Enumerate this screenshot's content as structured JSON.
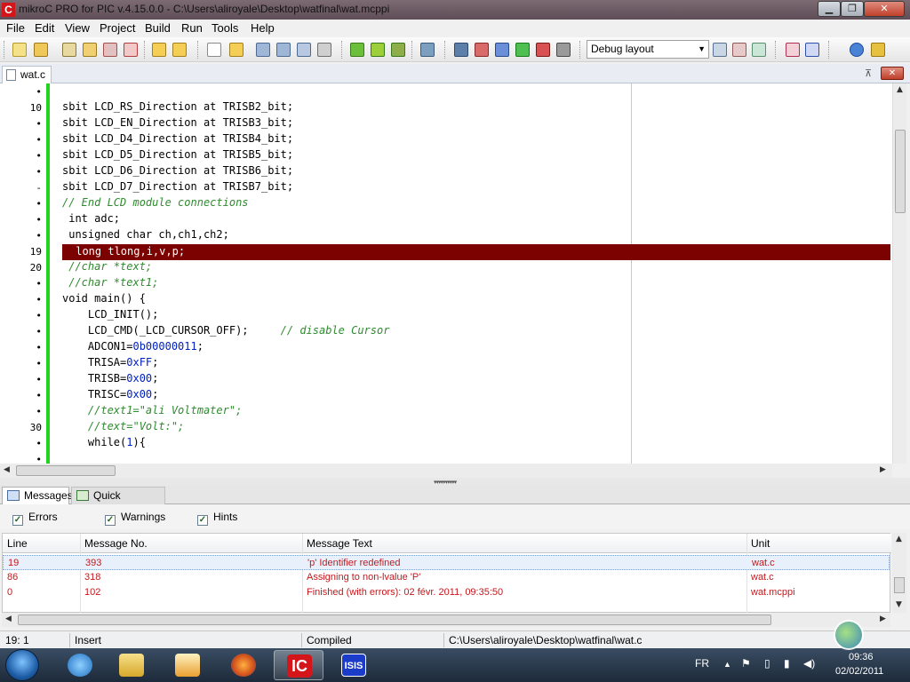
{
  "window": {
    "title": "mikroC PRO for PIC v.4.15.0.0 - C:\\Users\\aliroyale\\Desktop\\watfinal\\wat.mcppi",
    "app_icon_letter": "C",
    "min_glyph": "▁",
    "max_glyph": "❐",
    "close_glyph": "✕"
  },
  "menu": [
    "File",
    "Edit",
    "View",
    "Project",
    "Build",
    "Run",
    "Tools",
    "Help"
  ],
  "toolbar": {
    "layout_value": "Debug layout",
    "icons": [
      "new-project-icon",
      "open-project-icon",
      "save-project-icon",
      "close-project-icon",
      "project-options-icon",
      "open-folder-icon",
      "add-file-icon",
      "new-file-icon",
      "open-file-icon",
      "save-file-icon",
      "save-all-icon",
      "save-as-icon",
      "print-icon",
      "build-icon",
      "build-all-icon",
      "build-run-icon",
      "programmer-icon",
      "debug-icon",
      "statistics-icon",
      "text-icon",
      "help-icon",
      "tools-icon",
      "options-icon",
      "layout-save-icon",
      "layout-delete-icon",
      "layout-window-icon",
      "italic-a-icon",
      "italic-i-icon",
      "help-circle-icon",
      "key-icon"
    ]
  },
  "editor": {
    "tab_label": "wat.c",
    "pin_glyph": "⊼",
    "close_glyph": "✕",
    "lines": [
      {
        "ln": "•",
        "code": ""
      },
      {
        "ln": "10",
        "code": "sbit LCD_RS_Direction at TRISB2_bit;"
      },
      {
        "ln": "•",
        "code": "sbit LCD_EN_Direction at TRISB3_bit;"
      },
      {
        "ln": "•",
        "code": "sbit LCD_D4_Direction at TRISB4_bit;"
      },
      {
        "ln": "•",
        "code": "sbit LCD_D5_Direction at TRISB5_bit;"
      },
      {
        "ln": "•",
        "code": "sbit LCD_D6_Direction at TRISB6_bit;"
      },
      {
        "ln": "-",
        "code": "sbit LCD_D7_Direction at TRISB7_bit;"
      },
      {
        "ln": "•",
        "code": "// End LCD module connections",
        "comment": true
      },
      {
        "ln": "•",
        "code": " int adc;"
      },
      {
        "ln": "•",
        "code": " unsigned char ch,ch1,ch2;"
      },
      {
        "ln": "19",
        "code": " long tlong,i,v,p;",
        "highlight": true
      },
      {
        "ln": "20",
        "code": " //char *text;",
        "comment": true
      },
      {
        "ln": "•",
        "code": " //char *text1;",
        "comment": true
      },
      {
        "ln": "•",
        "code": "void main() {"
      },
      {
        "ln": "•",
        "code": "    LCD_INIT();"
      },
      {
        "ln": "•",
        "code": "    LCD_CMD(_LCD_CURSOR_OFF);",
        "trail_comment": "     // disable Cursor"
      },
      {
        "ln": "•",
        "code": "    ADCON1=",
        "num": "0b00000011",
        "after": ";"
      },
      {
        "ln": "•",
        "code": "    TRISA=",
        "num": "0xFF",
        "after": ";"
      },
      {
        "ln": "•",
        "code": "    TRISB=",
        "num": "0x00",
        "after": ";"
      },
      {
        "ln": "•",
        "code": "    TRISC=",
        "num": "0x00",
        "after": ";"
      },
      {
        "ln": "•",
        "code": "    //text1=\"ali Voltmater\";",
        "comment": true
      },
      {
        "ln": "30",
        "code": "    //text=\"Volt:\";",
        "comment": true
      },
      {
        "ln": "•",
        "code": "    while(",
        "num": "1",
        "after": "){"
      },
      {
        "ln": "•",
        "code": ""
      }
    ]
  },
  "messages_panel": {
    "tabs": [
      "Messages",
      "Quick Converter"
    ],
    "filters": [
      {
        "label": "Errors",
        "checked": true
      },
      {
        "label": "Warnings",
        "checked": true
      },
      {
        "label": "Hints",
        "checked": true
      }
    ],
    "columns": [
      "Line",
      "Message No.",
      "Message Text",
      "Unit"
    ],
    "rows": [
      {
        "line": "19",
        "no": "393",
        "text": "'p' Identifier redefined",
        "unit": "wat.c",
        "selected": true
      },
      {
        "line": "86",
        "no": "318",
        "text": "Assigning to non-lvalue 'P'",
        "unit": "wat.c"
      },
      {
        "line": "0",
        "no": "102",
        "text": "Finished (with errors): 02 févr. 2011, 09:35:50",
        "unit": "wat.mcppi"
      }
    ],
    "error_color": "#c8161b"
  },
  "statusbar": {
    "position": "19: 1",
    "mode": "Insert",
    "state": "Compiled",
    "path": "C:\\Users\\aliroyale\\Desktop\\watfinal\\wat.c"
  },
  "taskbar": {
    "apps": [
      "internet-explorer-icon",
      "file-explorer-icon",
      "media-player-icon",
      "firefox-icon",
      "mikroc-icon",
      "isis-icon"
    ],
    "active_app": "mikroc-icon",
    "mikroc_label": "IC",
    "isis_label": "ISIS",
    "lang": "FR",
    "tray_up": "▲",
    "time": "09:36",
    "date": "02/02/2011"
  },
  "colors": {
    "highlight_row": "#7c0101",
    "modified_bar": "#21d41f",
    "comment": "#2e8b2e",
    "number": "#0020c0"
  }
}
